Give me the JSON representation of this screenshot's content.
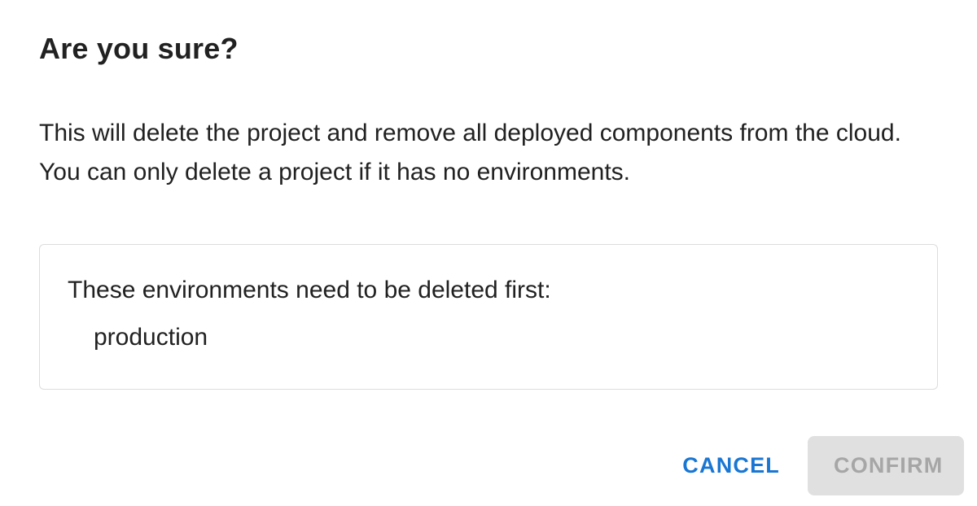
{
  "dialog": {
    "title": "Are you sure?",
    "message_line1": "This will delete the project and remove all deployed components from the cloud.",
    "message_line2": "You can only delete a project if it has no environments.",
    "environments_heading": "These environments need to be deleted first:",
    "environments": [
      "production"
    ],
    "cancel_label": "CANCEL",
    "confirm_label": "CONFIRM",
    "confirm_disabled": true
  },
  "colors": {
    "primary": "#1976d2",
    "text": "#212121",
    "disabled_bg": "#e0e0e0",
    "disabled_text": "#a6a6a6",
    "border": "#dcdcdc"
  }
}
